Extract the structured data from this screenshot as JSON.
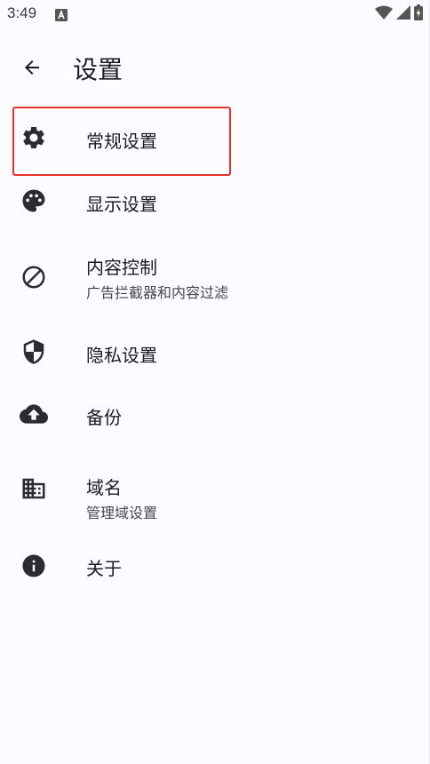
{
  "status_bar": {
    "time": "3:49",
    "icons": [
      "a-icon",
      "wifi-icon",
      "signal-icon",
      "battery-icon"
    ]
  },
  "app_bar": {
    "back_icon": "arrow-left-icon",
    "title": "设置"
  },
  "settings": [
    {
      "id": "general",
      "icon": "gear-icon",
      "title": "常规设置",
      "subtitle": ""
    },
    {
      "id": "display",
      "icon": "palette-icon",
      "title": "显示设置",
      "subtitle": ""
    },
    {
      "id": "content",
      "icon": "block-icon",
      "title": "内容控制",
      "subtitle": "广告拦截器和内容过滤"
    },
    {
      "id": "privacy",
      "icon": "shield-icon",
      "title": "隐私设置",
      "subtitle": ""
    },
    {
      "id": "backup",
      "icon": "cloud-upload-icon",
      "title": "备份",
      "subtitle": ""
    },
    {
      "id": "domains",
      "icon": "building-icon",
      "title": "域名",
      "subtitle": "管理域设置"
    },
    {
      "id": "about",
      "icon": "info-icon",
      "title": "关于",
      "subtitle": ""
    }
  ],
  "colors": {
    "background": "#fcfbff",
    "text": "#1c1b1f",
    "icon": "#2c2c30",
    "subtitle": "#49454f",
    "highlight": "#e5322d"
  }
}
